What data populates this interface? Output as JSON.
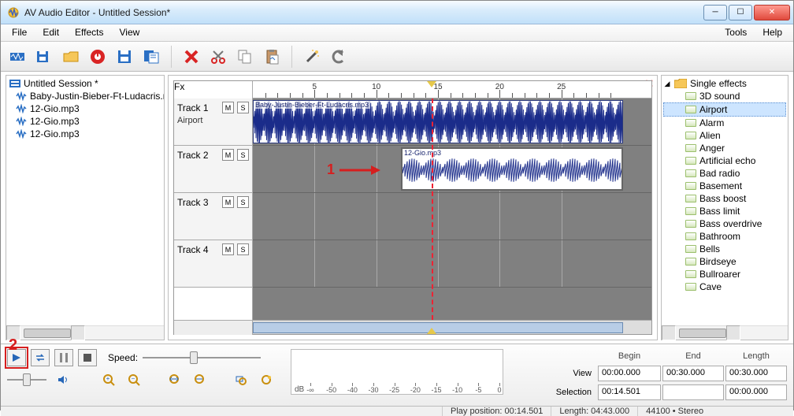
{
  "window": {
    "title": "AV Audio Editor - Untitled Session*"
  },
  "menubar": {
    "left": [
      "File",
      "Edit",
      "Effects",
      "View"
    ],
    "right": [
      "Tools",
      "Help"
    ]
  },
  "toolbar": {
    "buttons": [
      {
        "name": "new-session",
        "icon": "wave"
      },
      {
        "name": "open-session",
        "icon": "disk-open"
      },
      {
        "name": "open-file",
        "icon": "folder"
      },
      {
        "name": "record",
        "icon": "record"
      },
      {
        "name": "save",
        "icon": "save"
      },
      {
        "name": "save-as",
        "icon": "save-doc"
      }
    ],
    "buttons2": [
      {
        "name": "delete",
        "icon": "delete"
      },
      {
        "name": "cut",
        "icon": "scissors"
      },
      {
        "name": "copy",
        "icon": "copy"
      },
      {
        "name": "paste",
        "icon": "paste"
      }
    ],
    "buttons3": [
      {
        "name": "magic",
        "icon": "wand"
      },
      {
        "name": "undo",
        "icon": "undo"
      }
    ]
  },
  "session_tree": {
    "root": "Untitled Session *",
    "files": [
      "Baby-Justin-Bieber-Ft-Ludacris.m",
      "12-Gio.mp3",
      "12-Gio.mp3",
      "12-Gio.mp3"
    ]
  },
  "timeline": {
    "fx_label": "Fx",
    "ruler_ticks": [
      5,
      10,
      15,
      20,
      25
    ],
    "playhead_sec": 14.501,
    "range_start": 0,
    "range_end": 30
  },
  "tracks": [
    {
      "label": "Track 1",
      "effect": "Airport",
      "clips": [
        {
          "name": "Baby-Justin-Bieber-Ft-Ludacris.mp3",
          "start": 0,
          "end": 30,
          "selected": false
        }
      ]
    },
    {
      "label": "Track 2",
      "effect": "",
      "clips": [
        {
          "name": "12-Gio.mp3",
          "start": 12,
          "end": 30,
          "selected": true
        }
      ]
    },
    {
      "label": "Track 3",
      "effect": "",
      "clips": []
    },
    {
      "label": "Track 4",
      "effect": "",
      "clips": []
    }
  ],
  "ms_labels": {
    "mute": "M",
    "solo": "S"
  },
  "effects": {
    "root": "Single effects",
    "selected": "Airport",
    "items": [
      "3D sound",
      "Airport",
      "Alarm",
      "Alien",
      "Anger",
      "Artificial echo",
      "Bad radio",
      "Basement",
      "Bass boost",
      "Bass limit",
      "Bass overdrive",
      "Bathroom",
      "Bells",
      "Birdseye",
      "Bullroarer",
      "Cave"
    ]
  },
  "transport": {
    "speed_label": "Speed:",
    "meter_label": "dB",
    "meter_marks": [
      "-∞",
      "-50",
      "-40",
      "-30",
      "-25",
      "-20",
      "-15",
      "-10",
      "-5",
      "0"
    ]
  },
  "readouts": {
    "headers": [
      "Begin",
      "End",
      "Length"
    ],
    "rows": [
      {
        "label": "View",
        "begin": "00:00.000",
        "end": "00:30.000",
        "length": "00:30.000"
      },
      {
        "label": "Selection",
        "begin": "00:14.501",
        "end": "",
        "length": "00:00.000"
      }
    ]
  },
  "statusbar": {
    "play_position": "Play position: 00:14.501",
    "length": "Length: 04:43.000",
    "format": "44100 • Stereo"
  },
  "annotations": {
    "one": "1",
    "two": "2"
  }
}
